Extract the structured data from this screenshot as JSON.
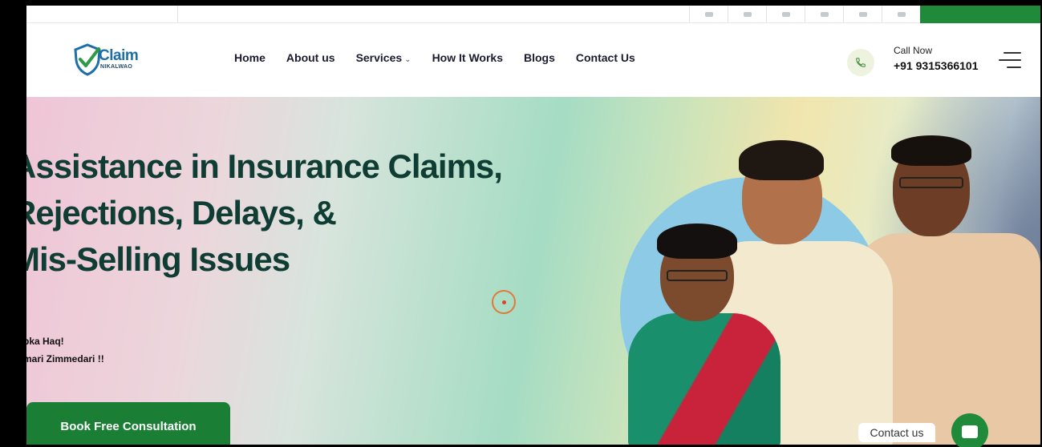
{
  "brand": {
    "logo_word": "Claim",
    "logo_sub": "NIKALWAO",
    "colors": {
      "primary_green": "#1a7f35",
      "headline": "#0f3d34",
      "logo_blue": "#1e6fa8"
    }
  },
  "nav": {
    "items": [
      {
        "label": "Home"
      },
      {
        "label": "About us"
      },
      {
        "label": "Services",
        "has_dropdown": true
      },
      {
        "label": "How It Works"
      },
      {
        "label": "Blogs"
      },
      {
        "label": "Contact Us"
      }
    ],
    "dropdown_chevron": "⌄",
    "call_label": "Call Now",
    "call_number": "+91 9315366101",
    "icons": {
      "phone": "phone-icon",
      "menu": "hamburger-menu-icon"
    }
  },
  "hero": {
    "headline_lines": [
      "Assistance in Insurance Claims,",
      "Rejections, Delays, &",
      "Mis-Selling Issues"
    ],
    "tagline_lines": [
      "pka Haq!",
      "mari Zimmedari !!"
    ],
    "cta_label": "Book Free Consultation"
  },
  "chat": {
    "label": "Contact us",
    "icon": "chat-icon"
  }
}
